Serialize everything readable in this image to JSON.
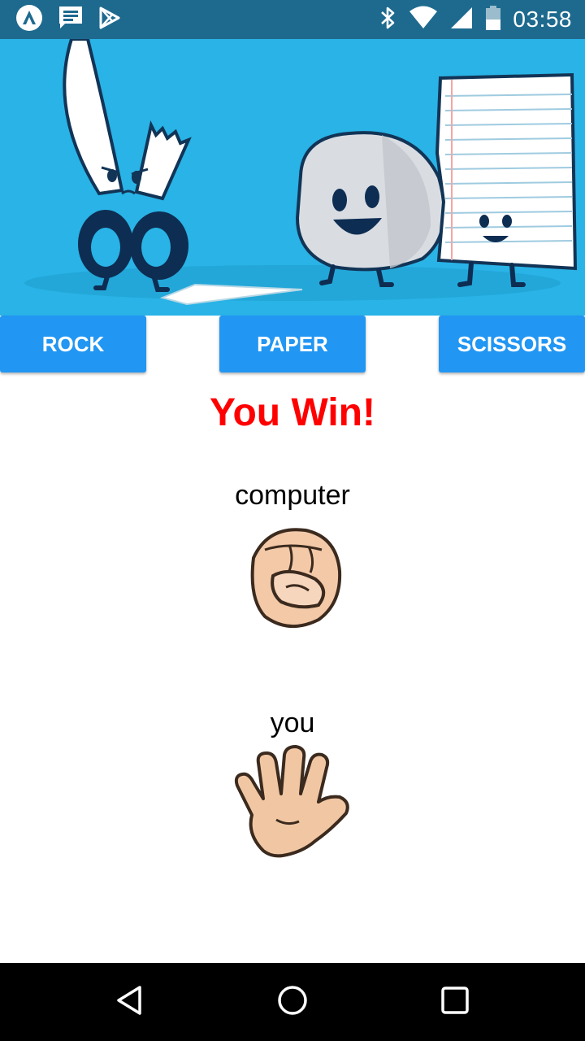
{
  "status_bar": {
    "time": "03:58",
    "left_icons": [
      "app-logo-icon",
      "message-icon",
      "play-store-icon"
    ],
    "right_icons": [
      "bluetooth-icon",
      "wifi-icon",
      "signal-icon",
      "battery-icon"
    ]
  },
  "buttons": {
    "rock": "ROCK",
    "paper": "PAPER",
    "scissors": "SCISSORS"
  },
  "result_text": "You Win!",
  "computer": {
    "label": "computer",
    "choice_icon": "rock-fist-icon"
  },
  "player": {
    "label": "you",
    "choice_icon": "paper-open-hand-icon"
  },
  "colors": {
    "status_bar": "#1e6a8f",
    "hero_background": "#29b3e6",
    "button": "#2196f3",
    "result": "#ff0000"
  },
  "navigation": [
    "back-icon",
    "home-icon",
    "recents-icon"
  ]
}
